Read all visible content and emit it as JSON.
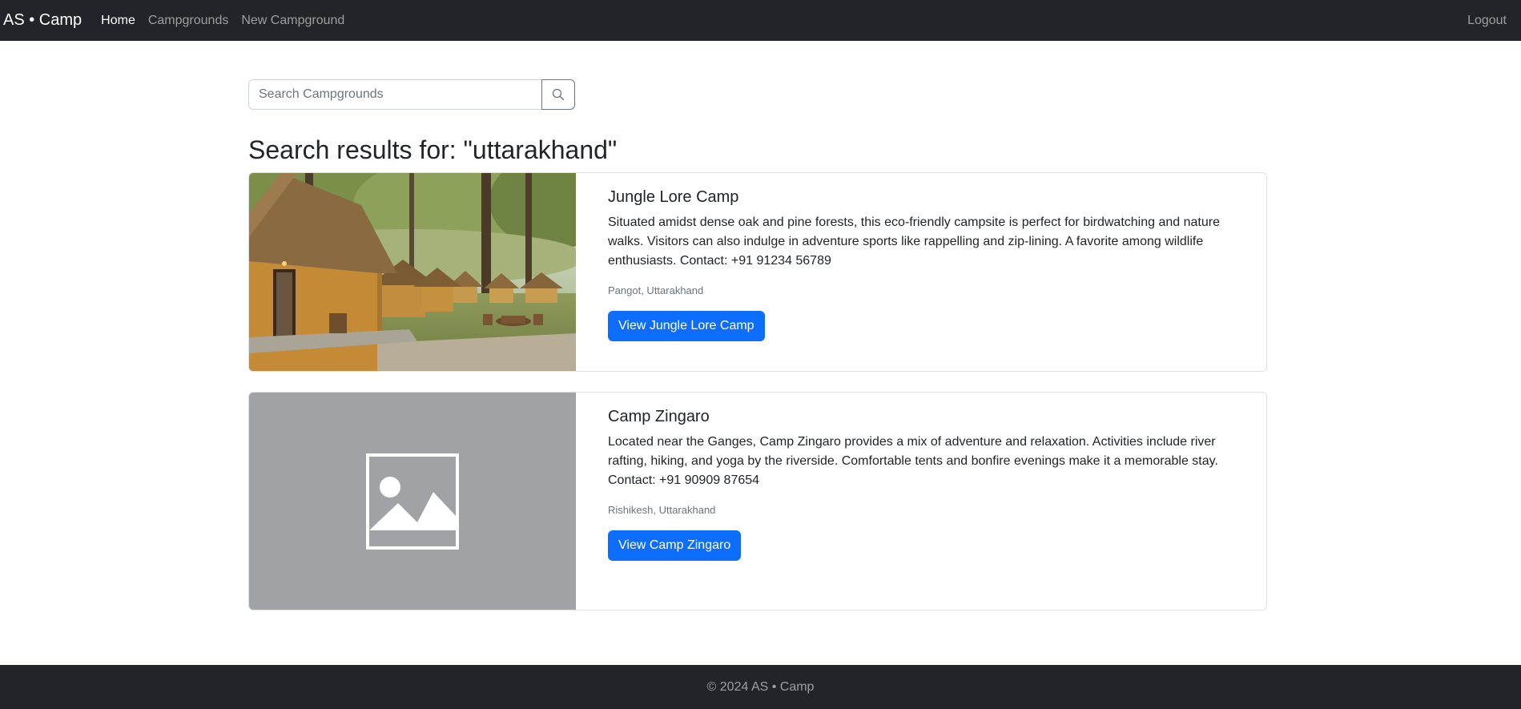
{
  "navbar": {
    "brand": "AS • Camp",
    "links": [
      {
        "label": "Home",
        "active": true
      },
      {
        "label": "Campgrounds",
        "active": false
      },
      {
        "label": "New Campground",
        "active": false
      }
    ],
    "logout": "Logout"
  },
  "search": {
    "placeholder": "Search Campgrounds",
    "value": "",
    "button_icon": "search-icon"
  },
  "results": {
    "heading": "Search results for: \"uttarakhand\"",
    "items": [
      {
        "title": "Jungle Lore Camp",
        "description": "Situated amidst dense oak and pine forests, this eco-friendly campsite is perfect for birdwatching and nature walks. Visitors can also indulge in adventure sports like rappelling and zip-lining. A favorite among wildlife enthusiasts. Contact: +91 91234 56789",
        "location": "Pangot, Uttarakhand",
        "button": "View Jungle Lore Camp",
        "image": "photo of thatched-roof cottages in a forest"
      },
      {
        "title": "Camp Zingaro",
        "description": "Located near the Ganges, Camp Zingaro provides a mix of adventure and relaxation. Activities include river rafting, hiking, and yoga by the riverside. Comfortable tents and bonfire evenings make it a memorable stay. Contact: +91 90909 87654",
        "location": "Rishikesh, Uttarakhand",
        "button": "View Camp Zingaro",
        "image": "image-placeholder-icon"
      }
    ]
  },
  "footer": {
    "text": "© 2024 AS • Camp"
  },
  "colors": {
    "navbar_bg": "#212529",
    "primary": "#0d6efd",
    "placeholder_bg": "#a0a2a6"
  }
}
